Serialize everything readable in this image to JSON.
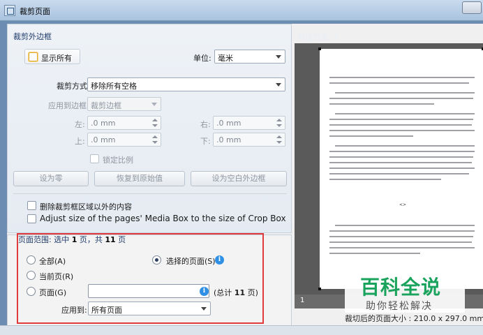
{
  "window": {
    "title": "裁剪页面"
  },
  "crop": {
    "section_title": "裁剪外边框",
    "show_all_label": "显示所有",
    "unit_label": "单位:",
    "unit_value": "毫米",
    "crop_mode_label": "裁剪方式",
    "crop_mode_value": "移除所有空格",
    "apply_to_margin_label": "应用到边框",
    "apply_to_margin_value": "裁剪边框",
    "left_label": "左:",
    "left_value": ".0 mm",
    "right_label": "右:",
    "right_value": ".0 mm",
    "top_label": "上:",
    "top_value": ".0 mm",
    "bottom_label": "下:",
    "bottom_value": ".0 mm",
    "lock_ratio_label": "锁定比例",
    "set_zero_label": "设为零",
    "restore_label": "恢复到原始值",
    "set_white_label": "设为空白外边框",
    "delete_outside_label": "删除裁剪框区域以外的内容",
    "adjust_media_label": "Adjust size of the pages' Media Box to the size of Crop Box"
  },
  "range": {
    "title_prefix": "页面范围: 选中 ",
    "selected": "1",
    "title_mid": " 页，共 ",
    "total": "11",
    "title_suffix": " 页",
    "all_label": "全部(A)",
    "selected_pages_label": "选择的页面(S)",
    "current_page_label": "当前页(R)",
    "pages_label": "页面(G)",
    "pages_input": "",
    "total_hint_prefix": "(总计 ",
    "total_hint_num": "11",
    "total_hint_suffix": " 页)",
    "apply_to_label": "应用到:",
    "apply_to_value": "所有页面"
  },
  "preview": {
    "label": "预览页面: 2",
    "page_mark": "<>",
    "page_number": "1",
    "size_text": "裁切后的页面大小 : 210.0 x 297.0 mm"
  },
  "watermark": {
    "main": "百科全说",
    "sub": "助你轻松解决"
  }
}
